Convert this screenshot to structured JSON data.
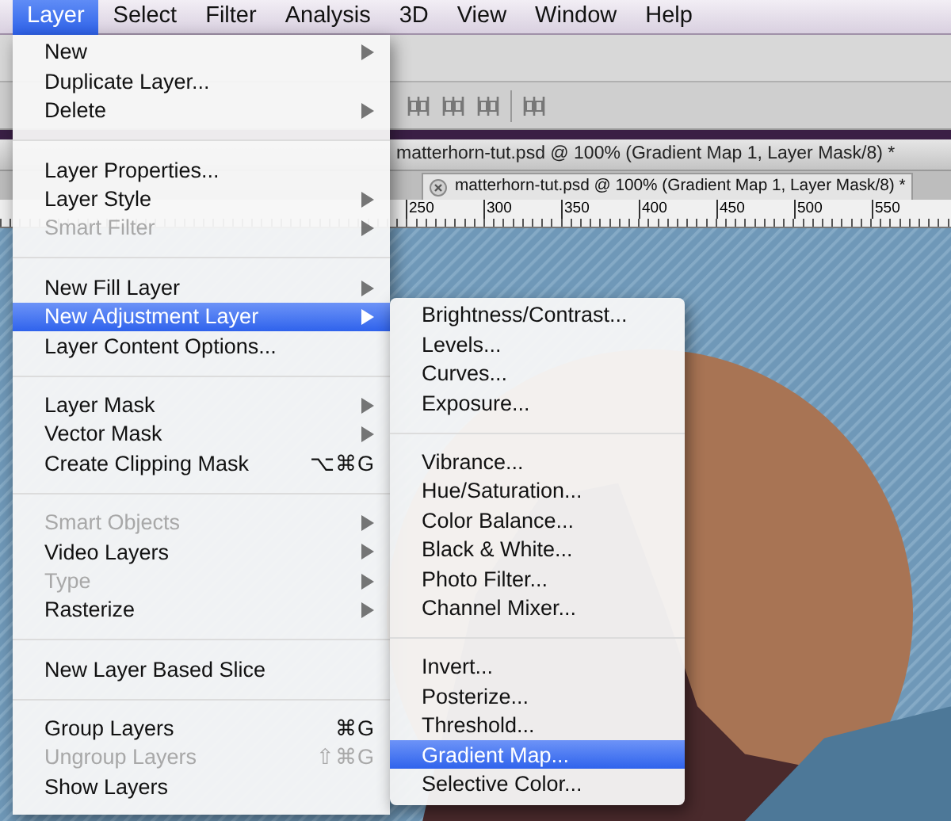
{
  "menubar": [
    {
      "label": "Layer",
      "selected": true
    },
    {
      "label": "Select",
      "selected": false
    },
    {
      "label": "Filter",
      "selected": false
    },
    {
      "label": "Analysis",
      "selected": false
    },
    {
      "label": "3D",
      "selected": false
    },
    {
      "label": "View",
      "selected": false
    },
    {
      "label": "Window",
      "selected": false
    },
    {
      "label": "Help",
      "selected": false
    }
  ],
  "document": {
    "title": "matterhorn-tut.psd @ 100% (Gradient Map 1, Layer Mask/8) *",
    "tab_title": "matterhorn-tut.psd @ 100% (Gradient Map 1, Layer Mask/8) *"
  },
  "ruler": {
    "labels": [
      "250",
      "300",
      "350",
      "400",
      "450",
      "500",
      "550"
    ]
  },
  "layer_menu": {
    "groups": [
      [
        {
          "label": "New",
          "submenu": true,
          "disabled": false,
          "selected": false
        },
        {
          "label": "Duplicate Layer...",
          "submenu": false,
          "disabled": false,
          "selected": false
        },
        {
          "label": "Delete",
          "submenu": true,
          "disabled": false,
          "selected": false
        }
      ],
      [
        {
          "label": "Layer Properties...",
          "submenu": false,
          "disabled": false,
          "selected": false
        },
        {
          "label": "Layer Style",
          "submenu": true,
          "disabled": false,
          "selected": false
        },
        {
          "label": "Smart Filter",
          "submenu": true,
          "disabled": true,
          "selected": false
        }
      ],
      [
        {
          "label": "New Fill Layer",
          "submenu": true,
          "disabled": false,
          "selected": false
        },
        {
          "label": "New Adjustment Layer",
          "submenu": true,
          "disabled": false,
          "selected": true
        },
        {
          "label": "Layer Content Options...",
          "submenu": false,
          "disabled": false,
          "selected": false
        }
      ],
      [
        {
          "label": "Layer Mask",
          "submenu": true,
          "disabled": false,
          "selected": false
        },
        {
          "label": "Vector Mask",
          "submenu": true,
          "disabled": false,
          "selected": false
        },
        {
          "label": "Create Clipping Mask",
          "shortcut": "⌥⌘G",
          "submenu": false,
          "disabled": false,
          "selected": false
        }
      ],
      [
        {
          "label": "Smart Objects",
          "submenu": true,
          "disabled": true,
          "selected": false
        },
        {
          "label": "Video Layers",
          "submenu": true,
          "disabled": false,
          "selected": false
        },
        {
          "label": "Type",
          "submenu": true,
          "disabled": true,
          "selected": false
        },
        {
          "label": "Rasterize",
          "submenu": true,
          "disabled": false,
          "selected": false
        }
      ],
      [
        {
          "label": "New Layer Based Slice",
          "submenu": false,
          "disabled": false,
          "selected": false
        }
      ],
      [
        {
          "label": "Group Layers",
          "shortcut": "⌘G",
          "submenu": false,
          "disabled": false,
          "selected": false
        },
        {
          "label": "Ungroup Layers",
          "shortcut": "⇧⌘G",
          "submenu": false,
          "disabled": true,
          "selected": false
        },
        {
          "label": "Show Layers",
          "submenu": false,
          "disabled": false,
          "selected": false
        }
      ]
    ]
  },
  "adjustment_submenu": {
    "groups": [
      [
        {
          "label": "Brightness/Contrast...",
          "selected": false
        },
        {
          "label": "Levels...",
          "selected": false
        },
        {
          "label": "Curves...",
          "selected": false
        },
        {
          "label": "Exposure...",
          "selected": false
        }
      ],
      [
        {
          "label": "Vibrance...",
          "selected": false
        },
        {
          "label": "Hue/Saturation...",
          "selected": false
        },
        {
          "label": "Color Balance...",
          "selected": false
        },
        {
          "label": "Black & White...",
          "selected": false
        },
        {
          "label": "Photo Filter...",
          "selected": false
        },
        {
          "label": "Channel Mixer...",
          "selected": false
        }
      ],
      [
        {
          "label": "Invert...",
          "selected": false
        },
        {
          "label": "Posterize...",
          "selected": false
        },
        {
          "label": "Threshold...",
          "selected": false
        },
        {
          "label": "Gradient Map...",
          "selected": true
        },
        {
          "label": "Selective Color...",
          "selected": false
        }
      ]
    ]
  }
}
